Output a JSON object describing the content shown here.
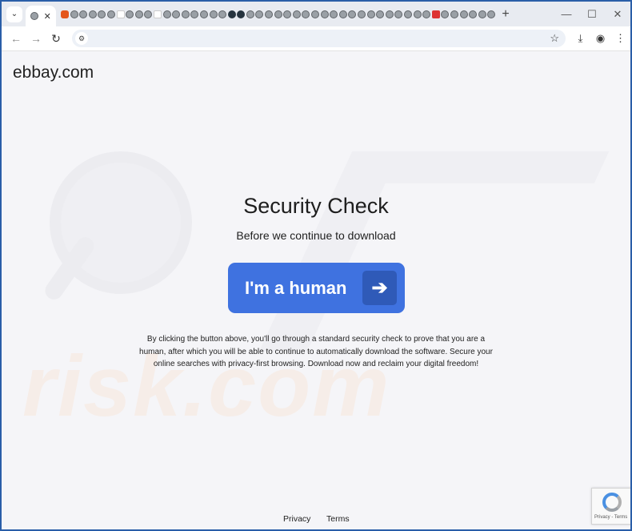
{
  "browser": {
    "tab_menu_icon": "chevron-down-icon",
    "tab_close_label": "✕",
    "favicon_count": 47,
    "new_tab_label": "+",
    "window_controls": {
      "minimize": "—",
      "maximize": "☐",
      "close": "✕"
    },
    "toolbar": {
      "back": "←",
      "forward": "→",
      "reload": "↻",
      "site_info_icon": "tune-icon",
      "address": "",
      "bookmark": "☆",
      "download": "⤓",
      "profile": "◉",
      "menu": "⋮"
    }
  },
  "page": {
    "brand": "ebbay.com",
    "title": "Security Check",
    "subtitle": "Before we continue to download",
    "cta": {
      "label": "I'm a human",
      "arrow": "➔"
    },
    "description": "By clicking the button above, you'll go through a standard security check to prove that you are a human, after which you will be able to continue to automatically download the software. Secure your online searches with privacy-first browsing. Download now and reclaim your digital freedom!",
    "footer": {
      "privacy": "Privacy",
      "terms": "Terms"
    },
    "recaptcha": {
      "caption": "Privacy - Terms"
    },
    "watermark": "risk.com"
  }
}
